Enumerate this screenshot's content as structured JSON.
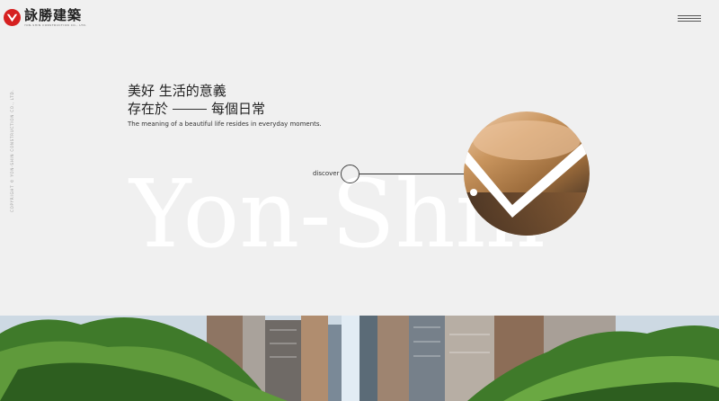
{
  "brand": {
    "name": "詠勝建築",
    "sub": "YON-SHIN CONSTRUCTION CO., LTD.",
    "accent": "#d62020"
  },
  "menu": {
    "icon": "hamburger-icon"
  },
  "side": {
    "copyright": "COPYRIGHT © YON-SHIN CONSTRUCTION CO., LTD."
  },
  "hero": {
    "line1": "美好 生活的意義",
    "line2_a": "存在於",
    "line2_b": "每個日常",
    "tagline": "The meaning of a beautiful life resides in everyday moments.",
    "big_word": "Yon-Shin",
    "discover": "discover"
  }
}
